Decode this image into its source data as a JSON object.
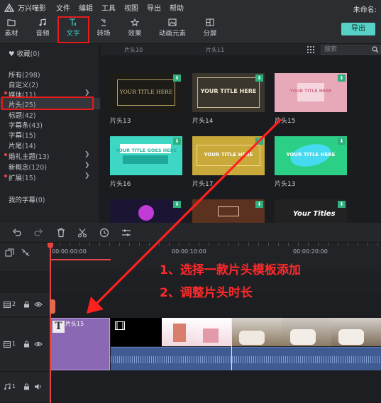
{
  "menubar": {
    "app_name": "万兴喵影",
    "items": [
      "文件",
      "编辑",
      "工具",
      "视图",
      "导出",
      "帮助"
    ],
    "project_name": "未命名:"
  },
  "toolbar": {
    "tabs": [
      {
        "label": "素材",
        "icon": "folder-icon"
      },
      {
        "label": "音频",
        "icon": "music-icon"
      },
      {
        "label": "文字",
        "icon": "text-icon"
      },
      {
        "label": "转场",
        "icon": "transition-icon"
      },
      {
        "label": "效果",
        "icon": "effects-icon"
      },
      {
        "label": "动画元素",
        "icon": "image-icon"
      },
      {
        "label": "分屏",
        "icon": "split-screen-icon"
      }
    ],
    "active_tab": "文字",
    "export_label": "导出"
  },
  "sidebar": {
    "favorites": "收藏",
    "favorites_count": "(0)",
    "items": [
      {
        "label": "所有",
        "count": "(298)"
      },
      {
        "label": "自定义",
        "count": "(2)"
      },
      {
        "label": "媒体",
        "count": "(11)"
      },
      {
        "label": "片头",
        "count": "(25)"
      },
      {
        "label": "标题",
        "count": "(42)"
      },
      {
        "label": "字幕条",
        "count": "(43)"
      },
      {
        "label": "字幕",
        "count": "(15)"
      },
      {
        "label": "片尾",
        "count": "(14)"
      },
      {
        "label": "婚礼主题",
        "count": "(13)"
      },
      {
        "label": "新概念",
        "count": "(120)"
      },
      {
        "label": "扩展",
        "count": "(15)"
      }
    ],
    "my_subtitles": "我的字幕",
    "my_subtitles_count": "(0)",
    "selected": "片头"
  },
  "content": {
    "search_placeholder": "搜索",
    "top_partial_labels": [
      "片头10",
      "片头11"
    ],
    "thumbs": [
      {
        "label": "片头13",
        "text": "YOUR TITLE HERE",
        "bg": "#1e1c17",
        "fg": "#d6c38e"
      },
      {
        "label": "片头14",
        "text": "YOUR TITLE HERE",
        "bg": "#3a362e",
        "fg": "#f0e7d2"
      },
      {
        "label": "片头15",
        "text": "YOUR TITLE HERE",
        "bg": "#e7a9b8",
        "fg": "#ffffff"
      },
      {
        "label": "片头16",
        "text": "YOUR TITLE GOES HERE",
        "bg": "#3ed7c3",
        "fg": "#ffffff"
      },
      {
        "label": "片头17",
        "text": "YOUR TITLE HERE",
        "bg": "#c9a93a",
        "fg": "#ffffff"
      },
      {
        "label": "片头13",
        "text": "YOUR TITLE HERE",
        "bg": "#2ccf86",
        "fg": "#ffffff"
      },
      {
        "label": "",
        "text": "",
        "bg": "#1b1533",
        "fg": "#ffffff"
      },
      {
        "label": "",
        "text": "",
        "bg": "#5b3220",
        "fg": "#ffffff"
      },
      {
        "label": "",
        "text": "Your Titles",
        "bg": "#222222",
        "fg": "#ffffff"
      }
    ]
  },
  "timeline": {
    "times": [
      "00:00:00:00",
      "00:00:10:00",
      "00:00:20:00"
    ],
    "tracks": [
      {
        "id": "2",
        "kind": "video"
      },
      {
        "id": "1",
        "kind": "video"
      },
      {
        "id": "1",
        "kind": "audio"
      }
    ],
    "title_clip": "片头15"
  },
  "annotations": {
    "line1": "1、选择一款片头模板添加",
    "line2": "2、调整片头时长"
  }
}
